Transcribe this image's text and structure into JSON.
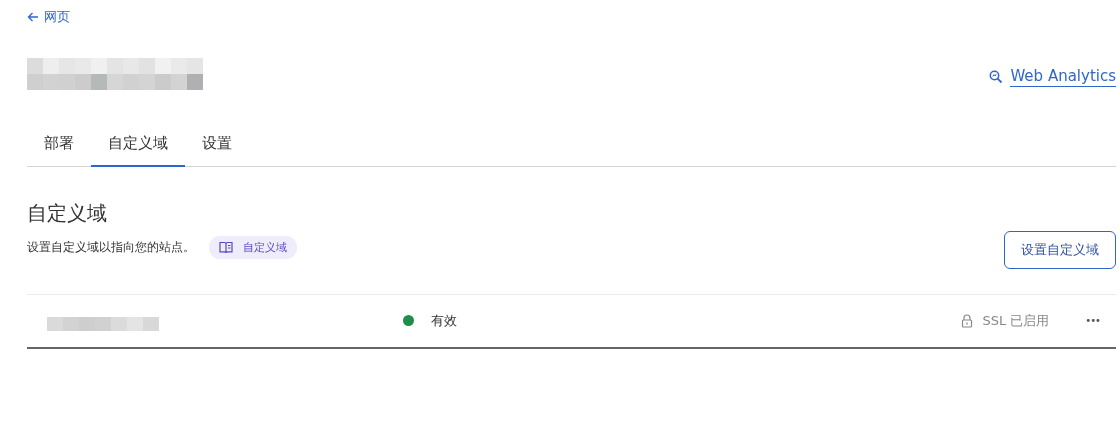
{
  "back_link": {
    "label": "网页"
  },
  "analytics_link": {
    "label": "Web Analytics"
  },
  "tabs": [
    {
      "label": "部署",
      "selected": false
    },
    {
      "label": "自定义域",
      "selected": true
    },
    {
      "label": "设置",
      "selected": false
    }
  ],
  "section": {
    "title": "自定义域",
    "description": "设置自定义域以指向您的站点。",
    "doc_tag": "自定义域",
    "button": "设置自定义域"
  },
  "domains": [
    {
      "status": "有效",
      "color": "#1e8e4a",
      "ssl": "SSL 已启用",
      "menu": "•••"
    }
  ]
}
